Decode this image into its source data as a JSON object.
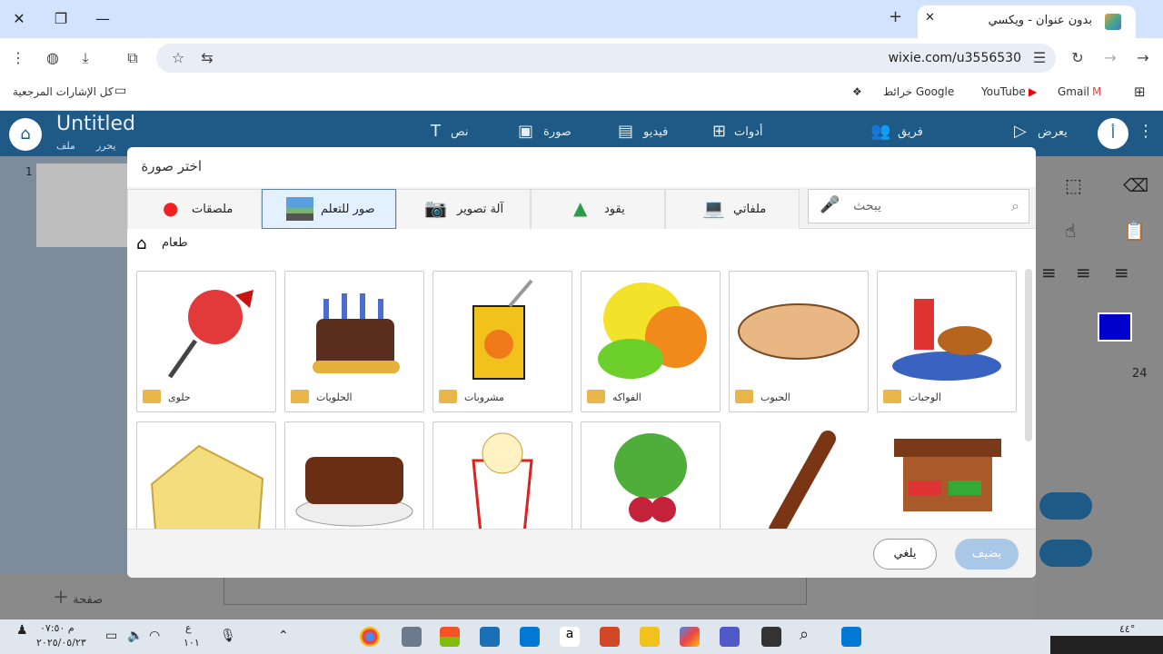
{
  "browser": {
    "tab_title": "بدون عنوان - ويكسي",
    "url": "wixie.com/u3556530",
    "bookmarks": {
      "all": "كل الإشارات المرجعية",
      "gmail": "Gmail",
      "youtube": "YouTube",
      "maps": "خرائط Google"
    }
  },
  "app": {
    "title": "Untitled",
    "menu_file": "ملف",
    "menu_edit": "يحرر",
    "nav": {
      "text": "نص",
      "image": "صورة",
      "video": "فيديو",
      "tools": "أدوات",
      "team": "فريق",
      "present": "يعرض"
    },
    "avatar_letter": "أ",
    "page_add": "صفحة",
    "page_number": "1",
    "font_size": "24"
  },
  "dialog": {
    "title": "اختر صورة",
    "tabs": {
      "stickers": "ملصقات",
      "learning": "صور للتعلم",
      "camera": "آلة تصوير",
      "drive": "يقود",
      "myfiles": "ملفاتي"
    },
    "search_placeholder": "يبحث",
    "breadcrumb": "طعام",
    "cards": [
      "حلوى",
      "الحلويات",
      "مشروبات",
      "الفواكه",
      "الحبوب",
      "الوجبات"
    ],
    "cancel": "يلغي",
    "add": "يضيف"
  },
  "taskbar": {
    "time": "۰۷:٥۰ م",
    "date": "۲۰۲٥/۰٥/۲۳",
    "lang": "ع",
    "lang2": "١٠١",
    "temp": "٤٤°"
  },
  "colors": {
    "header": "#1e5a85",
    "tab_strip": "#d3e3fd",
    "add_button": "#a9c7e6",
    "folder": "#e9b649"
  }
}
